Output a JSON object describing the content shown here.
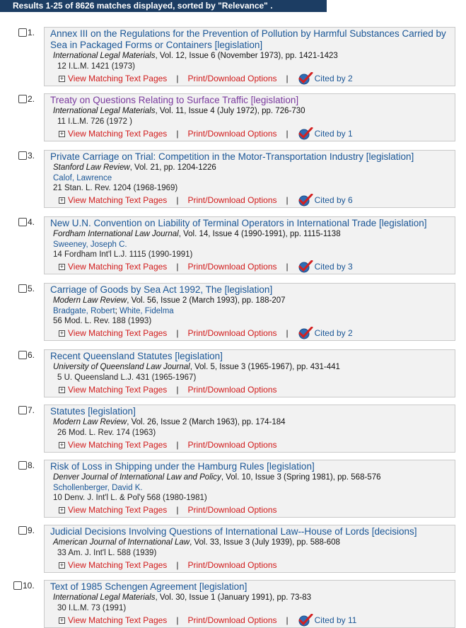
{
  "header": {
    "text": "Results 1-25 of 8626 matches displayed, sorted by \"Relevance\" ."
  },
  "labels": {
    "view_matching": "View Matching Text Pages",
    "print_download": "Print/Download Options",
    "pipe": "|",
    "plus": "+"
  },
  "results": [
    {
      "number": "1.",
      "title": "Annex III on the Regulations for the Prevention of Pollution by Harmful Substances Carried by Sea in Packaged Forms or Containers [legislation]",
      "journal_name": "International Legal Materials",
      "journal_details": ", Vol. 12, Issue 6 (November 1973), pp. 1421-1423",
      "authors": [],
      "citation": "12 I.L.M. 1421 (1973)",
      "cited_by": "Cited by 2"
    },
    {
      "number": "2.",
      "title": "Treaty on Questions Relating to Surface Traffic [legislation]",
      "journal_name": "International Legal Materials",
      "journal_details": ", Vol. 11, Issue 4 (July 1972), pp. 726-730",
      "authors": [],
      "citation": "11 I.L.M. 726 (1972 )",
      "cited_by": "Cited by 1"
    },
    {
      "number": "3.",
      "title": "Private Carriage on Trial: Competition in the Motor-Transportation Industry [legislation]",
      "journal_name": "Stanford Law Review",
      "journal_details": ", Vol. 21, pp. 1204-1226",
      "authors": [
        "Calof, Lawrence"
      ],
      "citation": "21 Stan. L. Rev. 1204 (1968-1969)",
      "cited_by": "Cited by 6"
    },
    {
      "number": "4.",
      "title": "New U.N. Convention on Liability of Terminal Operators in International Trade [legislation]",
      "journal_name": "Fordham International Law Journal",
      "journal_details": ", Vol. 14, Issue 4 (1990-1991), pp. 1115-1138",
      "authors": [
        "Sweeney, Joseph C."
      ],
      "citation": "14 Fordham Int'l L.J. 1115 (1990-1991)",
      "cited_by": "Cited by 3"
    },
    {
      "number": "5.",
      "title": "Carriage of Goods by Sea Act 1992, The [legislation]",
      "journal_name": "Modern Law Review",
      "journal_details": ", Vol. 56, Issue 2 (March 1993), pp. 188-207",
      "authors": [
        "Bradgate, Robert",
        "White, Fidelma"
      ],
      "author_sep": "; ",
      "citation": "56 Mod. L. Rev. 188 (1993)",
      "cited_by": "Cited by 2"
    },
    {
      "number": "6.",
      "title": "Recent Queensland Statutes [legislation]",
      "journal_name": "University of Queensland Law Journal",
      "journal_details": ", Vol. 5, Issue 3 (1965-1967), pp. 431-441",
      "authors": [],
      "citation": "5 U. Queensland L.J. 431 (1965-1967)",
      "cited_by": ""
    },
    {
      "number": "7.",
      "title": "Statutes [legislation]",
      "journal_name": "Modern Law Review",
      "journal_details": ", Vol. 26, Issue 2 (March 1963), pp. 174-184",
      "authors": [],
      "citation": "26 Mod. L. Rev. 174 (1963)",
      "cited_by": ""
    },
    {
      "number": "8.",
      "title": "Risk of Loss in Shipping under the Hamburg Rules [legislation]",
      "journal_name": "Denver Journal of International Law and Policy",
      "journal_details": ", Vol. 10, Issue 3 (Spring 1981), pp. 568-576",
      "authors": [
        "Schollenberger, David K."
      ],
      "citation": "10 Denv. J. Int'l L. & Pol'y 568 (1980-1981)",
      "cited_by": ""
    },
    {
      "number": "9.",
      "title": "Judicial Decisions Involving Questions of International Law--House of Lords [decisions]",
      "journal_name": "American Journal of International Law",
      "journal_details": ", Vol. 33, Issue 3 (July 1939), pp. 588-608",
      "authors": [],
      "citation": "33 Am. J. Int'l L. 588 (1939)",
      "cited_by": ""
    },
    {
      "number": "10.",
      "title": "Text of 1985 Schengen Agreement [legislation]",
      "journal_name": "International Legal Materials",
      "journal_details": ", Vol. 30, Issue 1 (January 1991), pp. 73-83",
      "authors": [],
      "citation": "30 I.L.M. 73 (1991)",
      "cited_by": "Cited by 11"
    }
  ]
}
